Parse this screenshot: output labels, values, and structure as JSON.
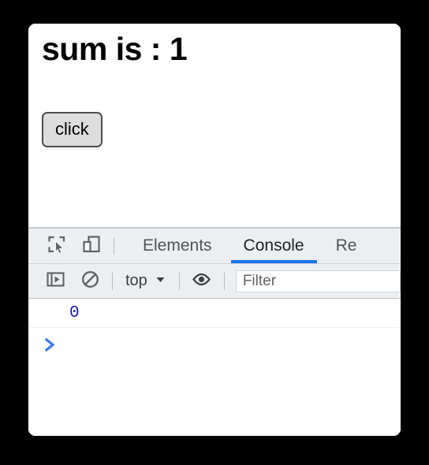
{
  "window": {
    "background_color": "#000000",
    "panel_color": "#ffffff"
  },
  "page": {
    "heading": "sum is : 1",
    "button_label": "click"
  },
  "devtools": {
    "toolbar_icons": [
      {
        "name": "inspect-element-icon",
        "title": "Inspect element"
      },
      {
        "name": "device-toolbar-icon",
        "title": "Toggle device toolbar"
      }
    ],
    "tabs": [
      {
        "label": "Elements",
        "active": false
      },
      {
        "label": "Console",
        "active": true
      },
      {
        "label": "Re",
        "active": false
      }
    ],
    "active_tab": "Console",
    "accent_color": "#1a73e8",
    "console_toolbar": {
      "sidebar_toggle_icon": "console-sidebar-icon",
      "clear_console_icon": "clear-console-icon",
      "context_label": "top",
      "context_chevron": "▼",
      "eye_icon": "live-expression-icon",
      "filter_placeholder": "Filter",
      "filter_value": ""
    },
    "console_messages": [
      {
        "type": "result",
        "text": "0",
        "color": "#1a1aa6"
      }
    ],
    "prompt_symbol": ">",
    "prompt_color": "#3b78e7"
  }
}
